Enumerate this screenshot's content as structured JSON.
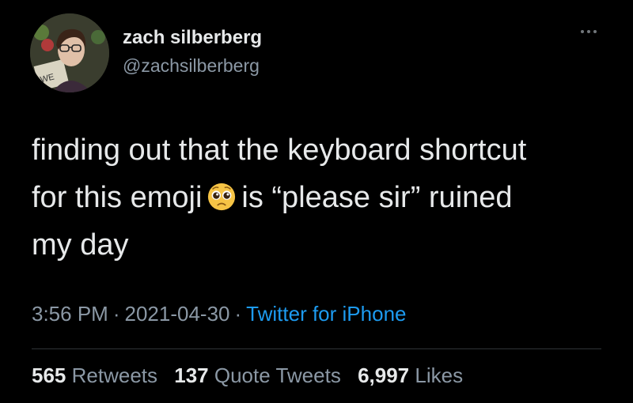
{
  "author": {
    "display_name": "zach silberberg",
    "handle": "@zachsilberberg"
  },
  "tweet": {
    "line1": "finding out that the keyboard shortcut",
    "line2_before": "for this emoji",
    "line2_after": "is “please sir” ruined",
    "line3": "my day",
    "emoji": "pleading-face-emoji"
  },
  "meta": {
    "time": "3:56 PM",
    "separator": "·",
    "date": "2021-04-30",
    "source": "Twitter for iPhone"
  },
  "stats": {
    "retweets_count": "565",
    "retweets_label": "Retweets",
    "quotes_count": "137",
    "quotes_label": "Quote Tweets",
    "likes_count": "6,997",
    "likes_label": "Likes"
  },
  "colors": {
    "background": "#000000",
    "text": "#e7e9ea",
    "secondary": "#8b98a5",
    "link": "#1d9bf0"
  },
  "icons": {
    "more": "more-horizontal-icon"
  }
}
